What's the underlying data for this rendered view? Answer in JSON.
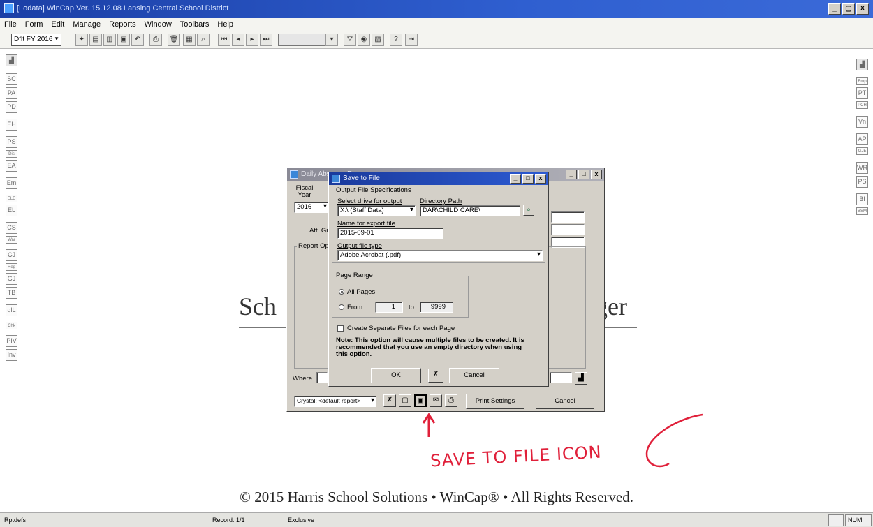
{
  "window": {
    "title": "[Lodata] WinCap Ver. 15.12.08   Lansing Central School District",
    "controls": [
      "_",
      "▢",
      "X"
    ]
  },
  "menu": [
    "File",
    "Form",
    "Edit",
    "Manage",
    "Reports",
    "Window",
    "Toolbars",
    "Help"
  ],
  "toolbar": {
    "fiscal_select": "Dflt FY 2016"
  },
  "sidebar_left": [
    "SC",
    "PA",
    "PD",
    "EH",
    "PS",
    "Dis",
    "EA",
    "Em",
    "ELE",
    "EL",
    "CS",
    "War",
    "CJ",
    "Reg",
    "GJ",
    "TB",
    "glL",
    "Chk",
    "PIV",
    "Inv"
  ],
  "sidebar_right": [
    "Emp",
    "PT",
    "PCH",
    "Vn",
    "AP",
    "GJE",
    "WR",
    "PS",
    "BI",
    "BSM"
  ],
  "background": {
    "title_left": "Sch",
    "title_right": "ger",
    "copyright": "© 2015 Harris School Solutions • WinCap® • All Rights Reserved."
  },
  "absence_dialog": {
    "title": "Daily Absence Report",
    "fiscal_label": "Fiscal Year",
    "fiscal_value": "2016",
    "att_label": "Att. Gr",
    "report_options_label": "Report Op",
    "where_label": "Where",
    "crystal_select": "Crystal: <default report>",
    "print_settings": "Print Settings",
    "cancel": "Cancel"
  },
  "save_dialog": {
    "title": "Save to File",
    "group_output": "Output File Specifications",
    "drive_label": "Select drive for output",
    "drive_value": "X:\\ (Staff Data)",
    "dir_label": "Directory Path",
    "dir_value": "DAR\\CHILD CARE\\",
    "name_label": "Name for export file",
    "name_value": "2015-09-01",
    "type_label": "Output file type",
    "type_value": "Adobe Acrobat (.pdf)",
    "page_range_label": "Page Range",
    "all_pages": "All Pages",
    "from_label": "From",
    "from_value": "1",
    "to_label": "to",
    "to_value": "9999",
    "separate_files": "Create Separate Files for each Page",
    "note": "Note: This option will cause multiple files to be created.  It is recommended that you use an empty directory when using this option.",
    "ok": "OK",
    "cancel": "Cancel"
  },
  "annotation": {
    "text": "SAVE TO FILE ICON",
    "color": "#e0203a"
  },
  "status": {
    "left": "Rptdefs",
    "record": "Record: 1/1",
    "mode": "Exclusive",
    "num": "NUM"
  }
}
